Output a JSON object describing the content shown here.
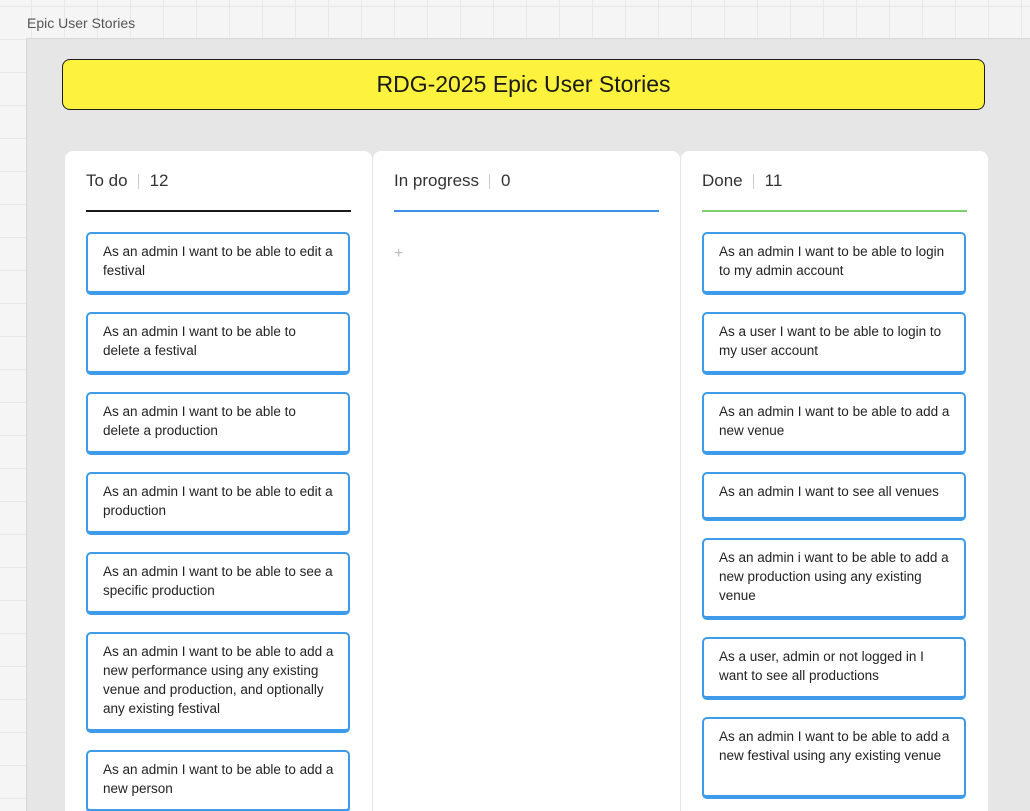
{
  "board": {
    "frame_label": "Epic User Stories",
    "title": "RDG-2025 Epic User Stories",
    "title_bg": "#fdf23e"
  },
  "columns": [
    {
      "name": "To do",
      "count": "12",
      "accent": "#1a1a1a",
      "cards": [
        "As an admin I want to be able to edit a festival",
        "As an admin I want to be able to delete a festival",
        "As an admin I want to be able to delete a production",
        "As an admin I want to be able to edit a production",
        "As an admin I want to be able to see a specific production",
        "As an admin I want to be able to add a new performance using any existing venue and production, and optionally any existing festival",
        "As an admin I want to be able to add a new person"
      ]
    },
    {
      "name": "In progress",
      "count": "0",
      "accent": "#3d8fe8",
      "add_icon": "+",
      "cards": []
    },
    {
      "name": "Done",
      "count": "11",
      "accent": "#7ccf6a",
      "cards": [
        "As an admin I want to be able to login to my admin account",
        "As a user I want to be able to login to my user account",
        "As an admin I want to be able to add a new venue",
        "As an admin I want to see all venues",
        "As an admin i want to be able to add a new production using any existing venue",
        "As a user, admin or not logged in I want to see all productions",
        "As an admin I want to be able to add a new festival using any existing venue"
      ]
    }
  ],
  "card_border_color": "#3d9be9"
}
